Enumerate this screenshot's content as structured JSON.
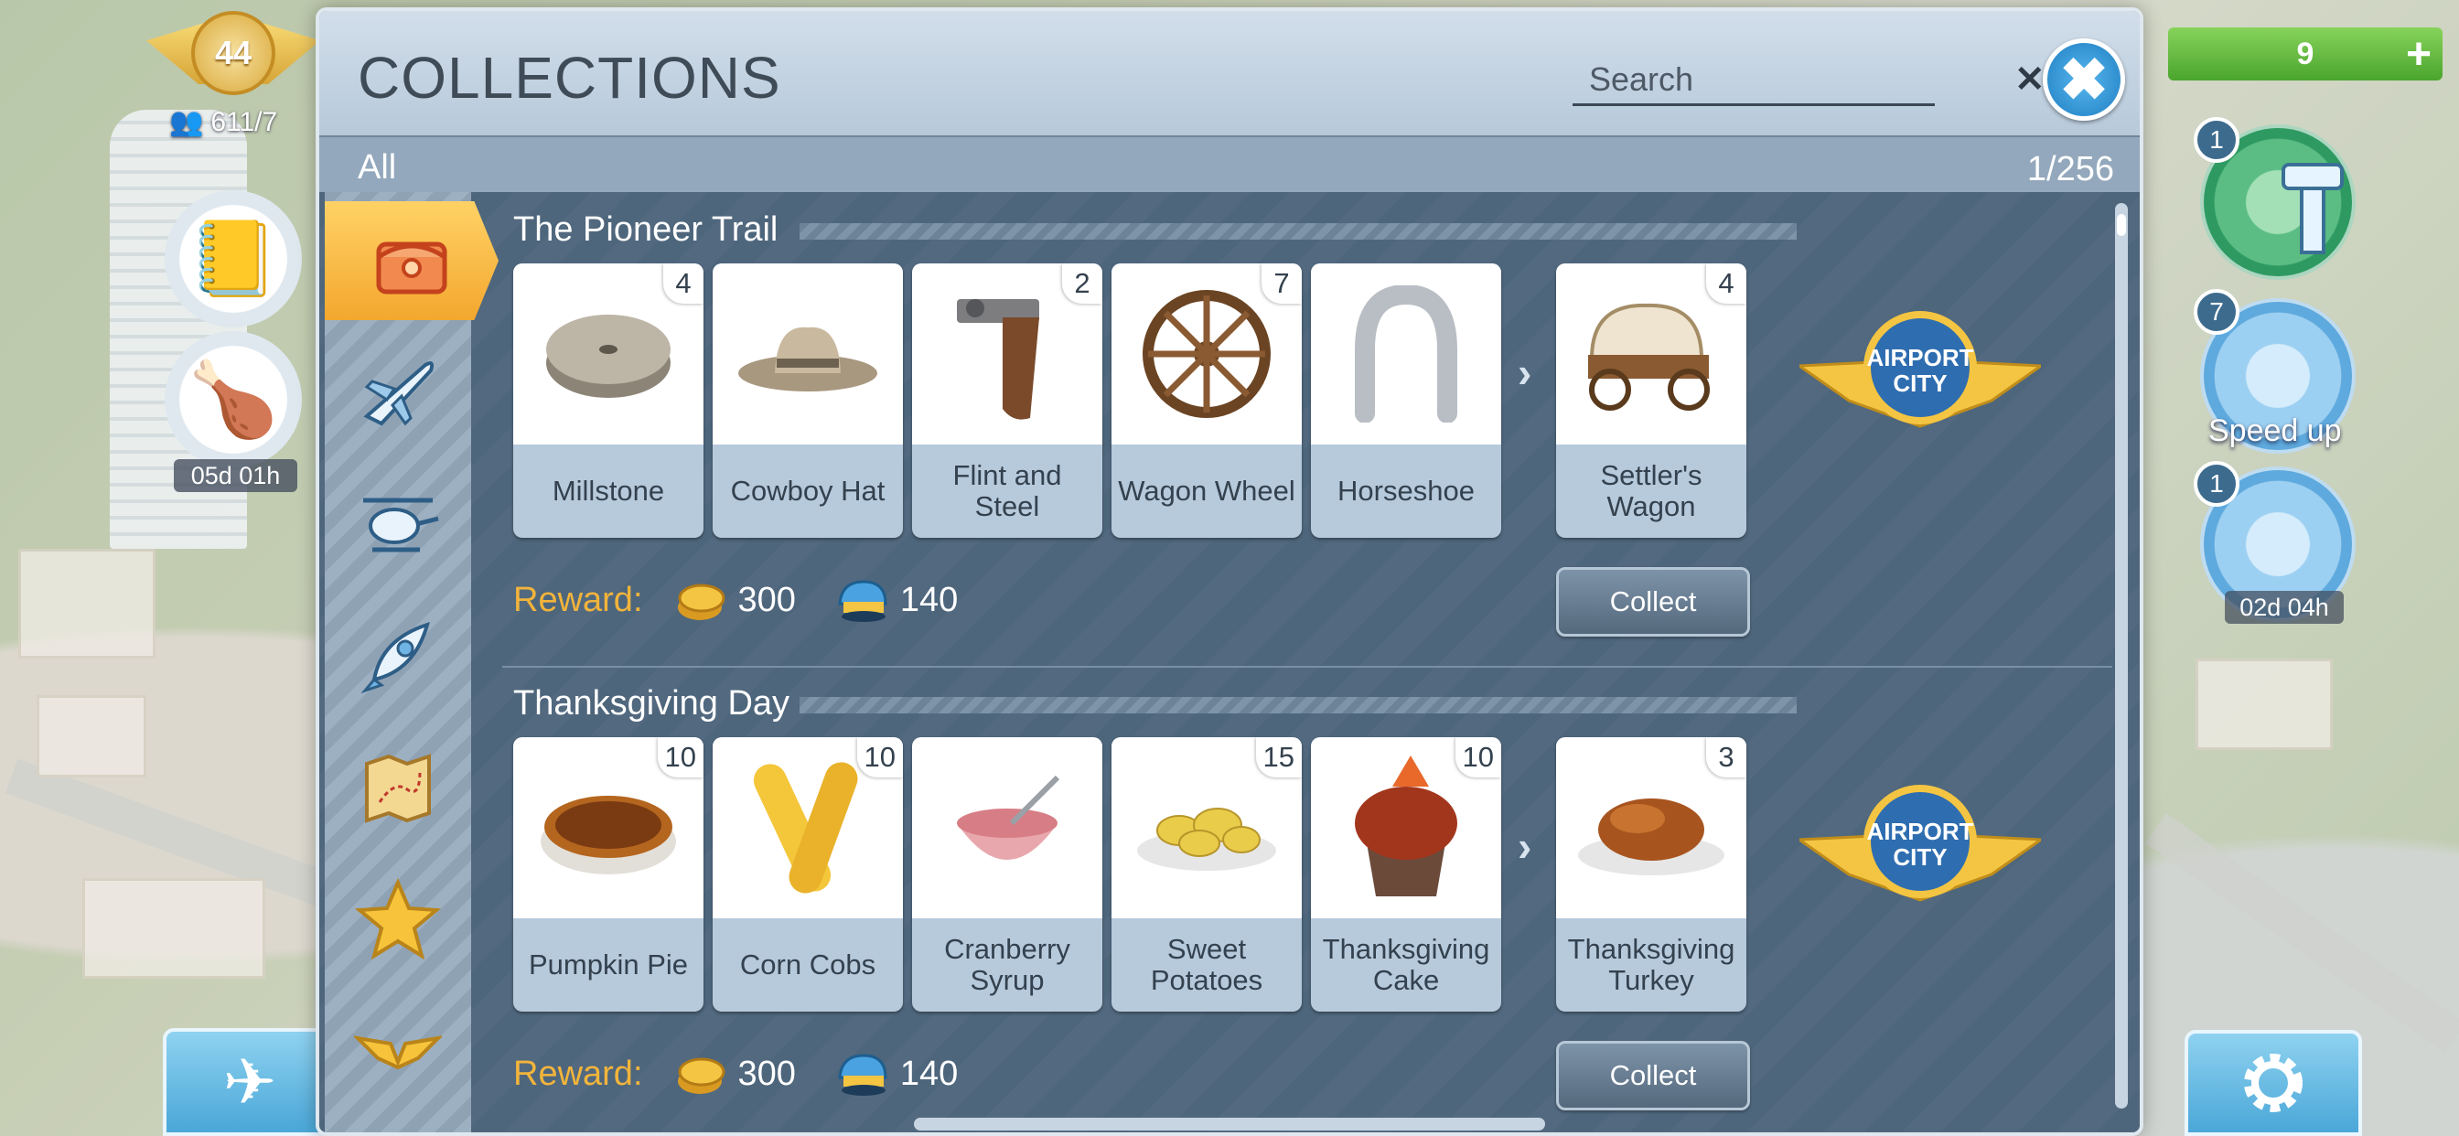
{
  "hud": {
    "level": "44",
    "population": "611/7",
    "side_timer": "05d 01h",
    "currency_value": "9",
    "tower_badge": "1",
    "speedup_badge": "7",
    "speedup_label": "Speed up",
    "gauge_badge": "1",
    "gauge_timer": "02d 04h"
  },
  "dialog": {
    "title": "COLLECTIONS",
    "search_placeholder": "Search",
    "filter_label": "All",
    "filter_count": "1/256"
  },
  "categories": [
    {
      "name": "chest-icon",
      "active": true
    },
    {
      "name": "airplane-icon",
      "active": false
    },
    {
      "name": "helicopter-icon",
      "active": false
    },
    {
      "name": "rocket-icon",
      "active": false
    },
    {
      "name": "treasure-map-icon",
      "active": false
    },
    {
      "name": "star-icon",
      "active": false
    },
    {
      "name": "wings-icon",
      "active": false
    }
  ],
  "collections": [
    {
      "title": "The Pioneer Trail",
      "items": [
        {
          "name": "Millstone",
          "count": "4",
          "icon": "millstone-icon"
        },
        {
          "name": "Cowboy Hat",
          "count": "",
          "icon": "cowboy-hat-icon"
        },
        {
          "name": "Flint and Steel",
          "count": "2",
          "icon": "flintlock-icon"
        },
        {
          "name": "Wagon Wheel",
          "count": "7",
          "icon": "wagon-wheel-icon"
        },
        {
          "name": "Horseshoe",
          "count": "",
          "icon": "horseshoe-icon"
        }
      ],
      "result": {
        "name": "Settler's Wagon",
        "count": "4",
        "icon": "covered-wagon-icon"
      },
      "reward_label": "Reward:",
      "reward_coins": "300",
      "reward_caps": "140",
      "collect_label": "Collect",
      "badge_text": "AIRPORT CITY"
    },
    {
      "title": "Thanksgiving Day",
      "items": [
        {
          "name": "Pumpkin Pie",
          "count": "10",
          "icon": "pie-icon"
        },
        {
          "name": "Corn Cobs",
          "count": "10",
          "icon": "corn-icon"
        },
        {
          "name": "Cranberry Syrup",
          "count": "",
          "icon": "syrup-bowl-icon"
        },
        {
          "name": "Sweet Potatoes",
          "count": "15",
          "icon": "potatoes-icon"
        },
        {
          "name": "Thanksgiving Cake",
          "count": "10",
          "icon": "cupcake-icon"
        }
      ],
      "result": {
        "name": "Thanksgiving Turkey",
        "count": "3",
        "icon": "turkey-icon"
      },
      "reward_label": "Reward:",
      "reward_coins": "300",
      "reward_caps": "140",
      "collect_label": "Collect",
      "badge_text": "AIRPORT CITY"
    }
  ]
}
